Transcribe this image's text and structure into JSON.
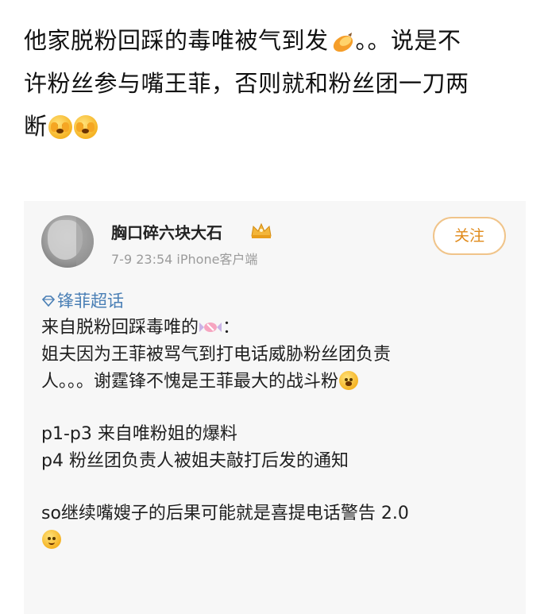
{
  "post": {
    "line1": "他家脱粉回踩的毒唯被气到发",
    "line1_tail": "。。说是不",
    "line2": "许粉丝参与嘴王菲，否则就和粉丝团一刀两",
    "line3": "断",
    "emojis": [
      "sweet-potato",
      "face-peeking",
      "face-peeking"
    ]
  },
  "quoted": {
    "username": "胸口碎六块大石",
    "meta": "7-9 23:54   iPhone客户端",
    "follow_label": "关注",
    "topic": "锋菲超话",
    "p1a": "来自脱粉回踩毒唯的",
    "p1b": "：",
    "p2": "姐夫因为王菲被骂气到打电话威胁粉丝团负责",
    "p3": "人。。。谢霆锋不愧是王菲最大的战斗粉",
    "p4": "p1-p3 来自唯粉姐的爆料",
    "p5": "p4 粉丝团负责人被姐夫敲打后发的通知",
    "p6": "so继续嘴嫂子的后果可能就是喜提电话警告 2.0"
  },
  "colors": {
    "topic": "#4a7fb5",
    "follow_border": "#f0c48a",
    "follow_text": "#e08a1a",
    "quote_bg": "#f7f7f7"
  }
}
